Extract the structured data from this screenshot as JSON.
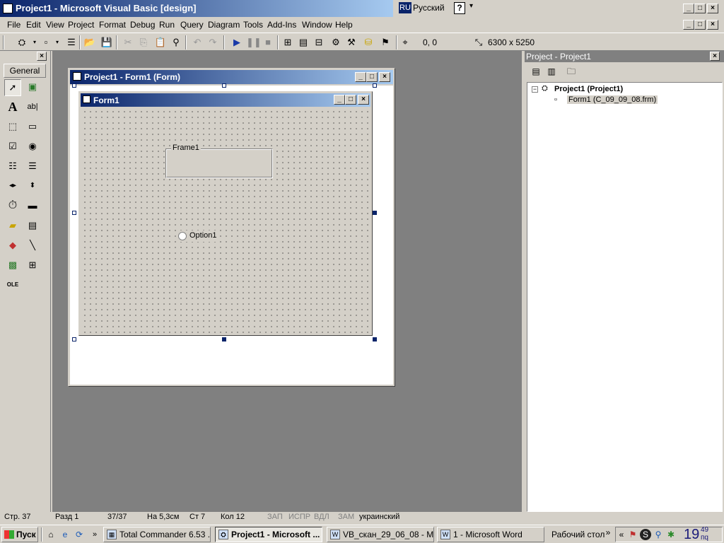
{
  "window": {
    "title": "Project1 - Microsoft Visual Basic [design]",
    "language_code": "RU",
    "language_name": "Русский",
    "help_glyph": "?"
  },
  "menu": [
    "File",
    "Edit",
    "View",
    "Project",
    "Format",
    "Debug",
    "Run",
    "Query",
    "Diagram",
    "Tools",
    "Add-Ins",
    "Window",
    "Help"
  ],
  "toolbar": {
    "position": "0, 0",
    "size": "6300 x 5250"
  },
  "toolbox": {
    "tab_label": "General",
    "tools": [
      "pointer-icon",
      "picturebox-icon",
      "label-icon",
      "textbox-icon",
      "frame-icon",
      "commandbutton-icon",
      "checkbox-icon",
      "optionbutton-icon",
      "combobox-icon",
      "listbox-icon",
      "hscrollbar-icon",
      "vscrollbar-icon",
      "timer-icon",
      "drivelistbox-icon",
      "dirlistbox-icon",
      "filelistbox-icon",
      "shape-icon",
      "line-icon",
      "image-icon",
      "data-icon",
      "ole-icon"
    ]
  },
  "designer": {
    "title": "Project1 - Form1 (Form)",
    "form_title": "Form1",
    "frame_caption": "Frame1",
    "option_caption": "Option1"
  },
  "project": {
    "title": "Project - Project1",
    "root": "Project1 (Project1)",
    "form_node": "Form1 (C_09_09_08.frm)"
  },
  "word_status": {
    "page": "Стр. 37",
    "section": "Разд 1",
    "pages": "37/37",
    "at": "На 5,3см",
    "line": "Ст 7",
    "col": "Кол 12",
    "rec": "ЗАП",
    "trk": "ИСПР",
    "ext": "ВДЛ",
    "ovr": "ЗАМ",
    "lang": "украинский"
  },
  "taskbar": {
    "start": "Пуск",
    "tasks": [
      {
        "label": "Total Commander 6.53 ...",
        "active": false
      },
      {
        "label": "Project1 - Microsoft ...",
        "active": true
      },
      {
        "label": "VB_скан_29_06_08 - M...",
        "active": false
      },
      {
        "label": "1 - Microsoft Word",
        "active": false
      }
    ],
    "desktop": "Рабочий стол",
    "clock": "19",
    "clock_min": "49",
    "clock_sub": "пq"
  }
}
